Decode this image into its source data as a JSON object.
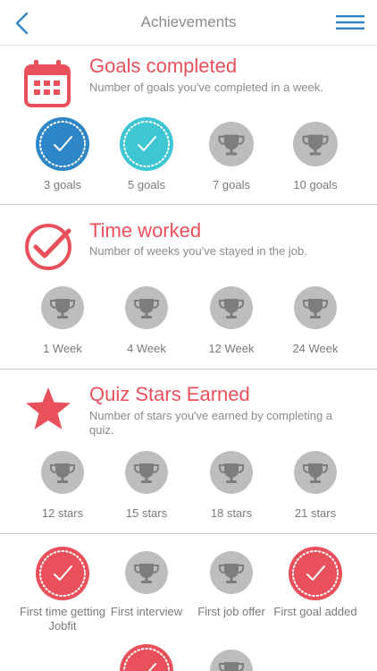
{
  "header": {
    "title": "Achievements",
    "back_icon": "chevron-left-icon",
    "menu_icon": "hamburger-menu-icon"
  },
  "colors": {
    "accent": "#e8505b",
    "blue": "#2f86c6",
    "teal": "#3ec6d3",
    "locked": "#bdbdbd",
    "text": "#8a8a8a"
  },
  "sections": [
    {
      "title": "Goals completed",
      "description": "Number of goals you've completed in a week.",
      "icon": "calendar-icon",
      "badges": [
        {
          "label": "3 goals",
          "state": "earned-blue"
        },
        {
          "label": "5 goals",
          "state": "earned-teal"
        },
        {
          "label": "7 goals",
          "state": "locked"
        },
        {
          "label": "10 goals",
          "state": "locked"
        }
      ]
    },
    {
      "title": "Time worked",
      "description": "Number of weeks you've stayed in the job.",
      "icon": "checkmark-circle-icon",
      "badges": [
        {
          "label": "1 Week",
          "state": "locked"
        },
        {
          "label": "4 Week",
          "state": "locked"
        },
        {
          "label": "12 Week",
          "state": "locked"
        },
        {
          "label": "24 Week",
          "state": "locked"
        }
      ]
    },
    {
      "title": "Quiz Stars Earned",
      "description": "Number of stars you've earned by completing a quiz.",
      "icon": "star-icon",
      "badges": [
        {
          "label": "12 stars",
          "state": "locked"
        },
        {
          "label": "15 stars",
          "state": "locked"
        },
        {
          "label": "18 stars",
          "state": "locked"
        },
        {
          "label": "21 stars",
          "state": "locked"
        }
      ]
    }
  ],
  "misc": {
    "badges": [
      {
        "label": "First time getting Jobfit",
        "state": "earned-red"
      },
      {
        "label": "First interview",
        "state": "locked"
      },
      {
        "label": "First job offer",
        "state": "locked"
      },
      {
        "label": "First goal added",
        "state": "earned-red"
      },
      {
        "label": "",
        "state": "earned-red"
      },
      {
        "label": "",
        "state": "locked"
      }
    ]
  }
}
